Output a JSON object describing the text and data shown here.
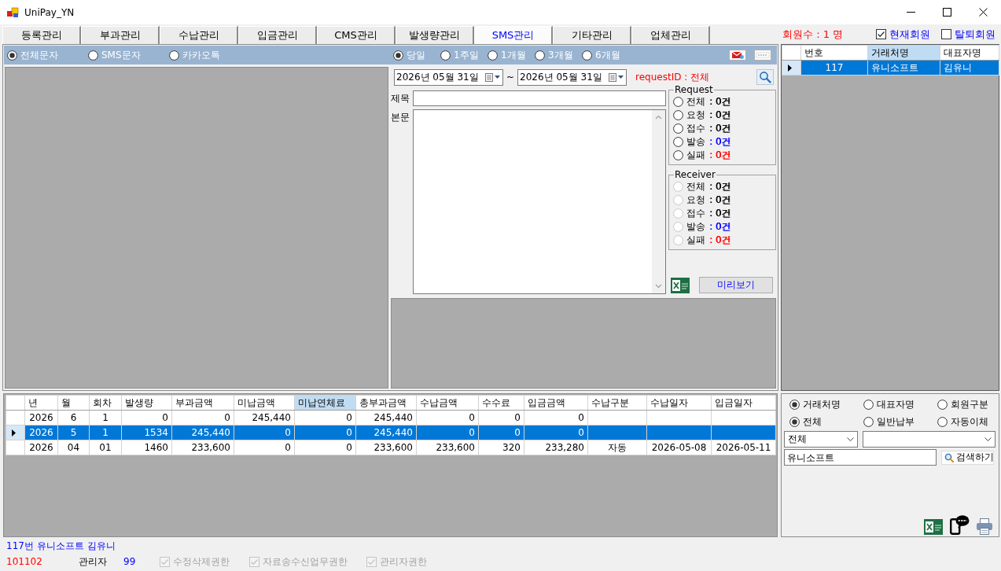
{
  "window": {
    "title": "UniPay_YN"
  },
  "tabs": [
    {
      "label": "등록관리",
      "selected": false
    },
    {
      "label": "부과관리",
      "selected": false
    },
    {
      "label": "수납관리",
      "selected": false
    },
    {
      "label": "입금관리",
      "selected": false
    },
    {
      "label": "CMS관리",
      "selected": false
    },
    {
      "label": "발생량관리",
      "selected": false
    },
    {
      "label": "SMS관리",
      "selected": true
    },
    {
      "label": "기타관리",
      "selected": false
    },
    {
      "label": "업체관리",
      "selected": false
    }
  ],
  "member_count": "회원수 : 1 명",
  "member_filters": [
    {
      "label": "현재회원",
      "checked": true
    },
    {
      "label": "탈퇴회원",
      "checked": false
    }
  ],
  "sms": {
    "message_types": [
      {
        "label": "전체문자",
        "selected": true
      },
      {
        "label": "SMS문자",
        "selected": false
      },
      {
        "label": "카카오톡",
        "selected": false
      }
    ],
    "periods": [
      {
        "label": "당일",
        "selected": true
      },
      {
        "label": "1주일",
        "selected": false
      },
      {
        "label": "1개월",
        "selected": false
      },
      {
        "label": "3개월",
        "selected": false
      },
      {
        "label": "6개월",
        "selected": false
      }
    ],
    "date_from": "2026년 05월 31일",
    "date_separator": "~",
    "date_to": "2026년 05월 31일",
    "request_id": "requestID : 전체",
    "subject_label": "제목",
    "body_label": "본문",
    "groups": [
      {
        "title": "Request",
        "items": [
          {
            "label": "전체",
            "count": ": 0건",
            "color": "#000000",
            "selected": false,
            "disabled": false
          },
          {
            "label": "요청",
            "count": ": 0건",
            "color": "#000000",
            "selected": false,
            "disabled": false
          },
          {
            "label": "접수",
            "count": ": 0건",
            "color": "#000000",
            "selected": false,
            "disabled": false
          },
          {
            "label": "발송",
            "count": ": 0건",
            "color": "#0000ff",
            "selected": false,
            "disabled": false
          },
          {
            "label": "실패",
            "count": ": 0건",
            "color": "#ff0000",
            "selected": false,
            "disabled": false
          }
        ]
      },
      {
        "title": "Receiver",
        "items": [
          {
            "label": "전체",
            "count": ": 0건",
            "color": "#000000",
            "selected": false,
            "disabled": true
          },
          {
            "label": "요청",
            "count": ": 0건",
            "color": "#000000",
            "selected": false,
            "disabled": true
          },
          {
            "label": "접수",
            "count": ": 0건",
            "color": "#000000",
            "selected": false,
            "disabled": true
          },
          {
            "label": "발송",
            "count": ": 0건",
            "color": "#0000ff",
            "selected": false,
            "disabled": true
          },
          {
            "label": "실패",
            "count": ": 0건",
            "color": "#ff0000",
            "selected": false,
            "disabled": true
          }
        ]
      }
    ],
    "preview_button": "미리보기"
  },
  "customers": {
    "columns": [
      {
        "label": "번호",
        "selected": false
      },
      {
        "label": "거래처명",
        "selected": true
      },
      {
        "label": "대표자명",
        "selected": false
      }
    ],
    "rows": [
      {
        "cells": [
          "117",
          "유니소프트",
          "김유니"
        ],
        "selected": true
      }
    ]
  },
  "billing": {
    "columns": [
      {
        "label": "년",
        "selected": false
      },
      {
        "label": "월",
        "selected": false
      },
      {
        "label": "회차",
        "selected": false
      },
      {
        "label": "발생량",
        "selected": false
      },
      {
        "label": "부과금액",
        "selected": false
      },
      {
        "label": "미납금액",
        "selected": false
      },
      {
        "label": "미납연체료",
        "selected": true
      },
      {
        "label": "총부과금액",
        "selected": false
      },
      {
        "label": "수납금액",
        "selected": false
      },
      {
        "label": "수수료",
        "selected": false
      },
      {
        "label": "입금금액",
        "selected": false
      },
      {
        "label": "수납구분",
        "selected": false
      },
      {
        "label": "수납일자",
        "selected": false
      },
      {
        "label": "입금일자",
        "selected": false
      }
    ],
    "rows": [
      {
        "cells": [
          "2026",
          "6",
          "1",
          "0",
          "0",
          "245,440",
          "0",
          "245,440",
          "0",
          "0",
          "0"
        ],
        "selected": false
      },
      {
        "cells": [
          "2026",
          "5",
          "1",
          "1534",
          "245,440",
          "0",
          "0",
          "245,440",
          "0",
          "0",
          "0"
        ],
        "selected": true
      },
      {
        "cells": [
          "2026",
          "04",
          "01",
          "1460",
          "233,600",
          "0",
          "0",
          "233,600",
          "233,600",
          "320",
          "233,280",
          "자동",
          "2026-05-08",
          "2026-05-11"
        ],
        "selected": false
      }
    ]
  },
  "search": {
    "search_by": [
      {
        "label": "거래처명",
        "selected": true
      },
      {
        "label": "대표자명",
        "selected": false
      },
      {
        "label": "회원구분",
        "selected": false
      }
    ],
    "payment_types": [
      {
        "label": "전체",
        "selected": true
      },
      {
        "label": "일반납부",
        "selected": false
      },
      {
        "label": "자동이체",
        "selected": false
      }
    ],
    "category": {
      "value": "전체"
    },
    "keyword": {
      "value": "유니소프트"
    },
    "button": "검색하기"
  },
  "status": {
    "selected_member": "117번 유니소프트 김유니",
    "user_code": "101102",
    "role": "관리자",
    "grade": "99",
    "permissions": [
      {
        "label": "수정삭제권한",
        "checked": true,
        "disabled": true
      },
      {
        "label": "자료송수신업무권한",
        "checked": true,
        "disabled": true
      },
      {
        "label": "관리자권한",
        "checked": true,
        "disabled": true
      }
    ]
  }
}
